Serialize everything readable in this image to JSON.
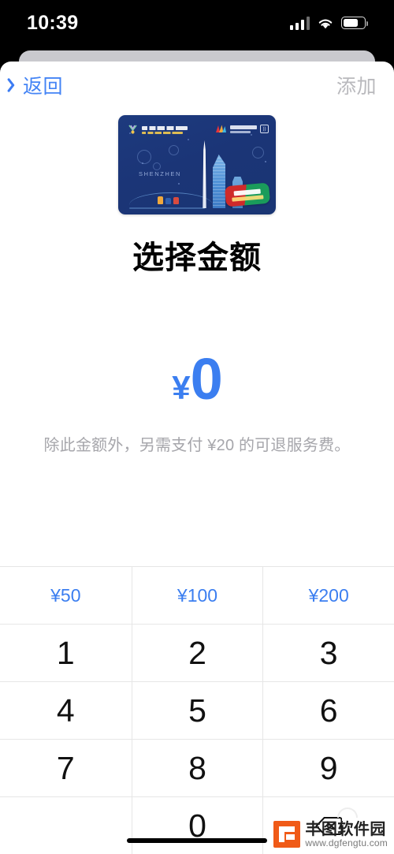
{
  "status_bar": {
    "time": "10:39",
    "signal_icon": "cellular-signal-icon",
    "wifi_icon": "wifi-icon",
    "battery_icon": "battery-icon",
    "battery_level_pct": 72
  },
  "nav": {
    "back_label": "返回",
    "back_icon": "chevron-left-icon",
    "add_label": "添加"
  },
  "card": {
    "city_label": "SHENZHEN",
    "accent_blue": "#1d3a7e",
    "badge_red": "#cf2a2a",
    "badge_green": "#1a9c5b"
  },
  "page": {
    "title": "选择金额",
    "currency_symbol": "¥",
    "amount_value": "0",
    "amount_color": "#3b7ef0",
    "fee_note": "除此金额外，另需支付 ¥20 的可退服务费。"
  },
  "quick_amounts": [
    {
      "label": "¥50"
    },
    {
      "label": "¥100"
    },
    {
      "label": "¥200"
    }
  ],
  "keypad": {
    "rows": [
      [
        {
          "label": "1",
          "type": "digit"
        },
        {
          "label": "2",
          "type": "digit"
        },
        {
          "label": "3",
          "type": "digit"
        }
      ],
      [
        {
          "label": "4",
          "type": "digit"
        },
        {
          "label": "5",
          "type": "digit"
        },
        {
          "label": "6",
          "type": "digit"
        }
      ],
      [
        {
          "label": "7",
          "type": "digit"
        },
        {
          "label": "8",
          "type": "digit"
        },
        {
          "label": "9",
          "type": "digit"
        }
      ],
      [
        {
          "label": "",
          "type": "empty"
        },
        {
          "label": "0",
          "type": "digit"
        },
        {
          "label": "",
          "type": "delete",
          "icon": "backspace-icon"
        }
      ]
    ]
  },
  "watermark": {
    "name": "丰图软件园",
    "url": "www.dgfengtu.com",
    "logo_color": "#f05a17"
  },
  "home_indicator": "home-indicator"
}
